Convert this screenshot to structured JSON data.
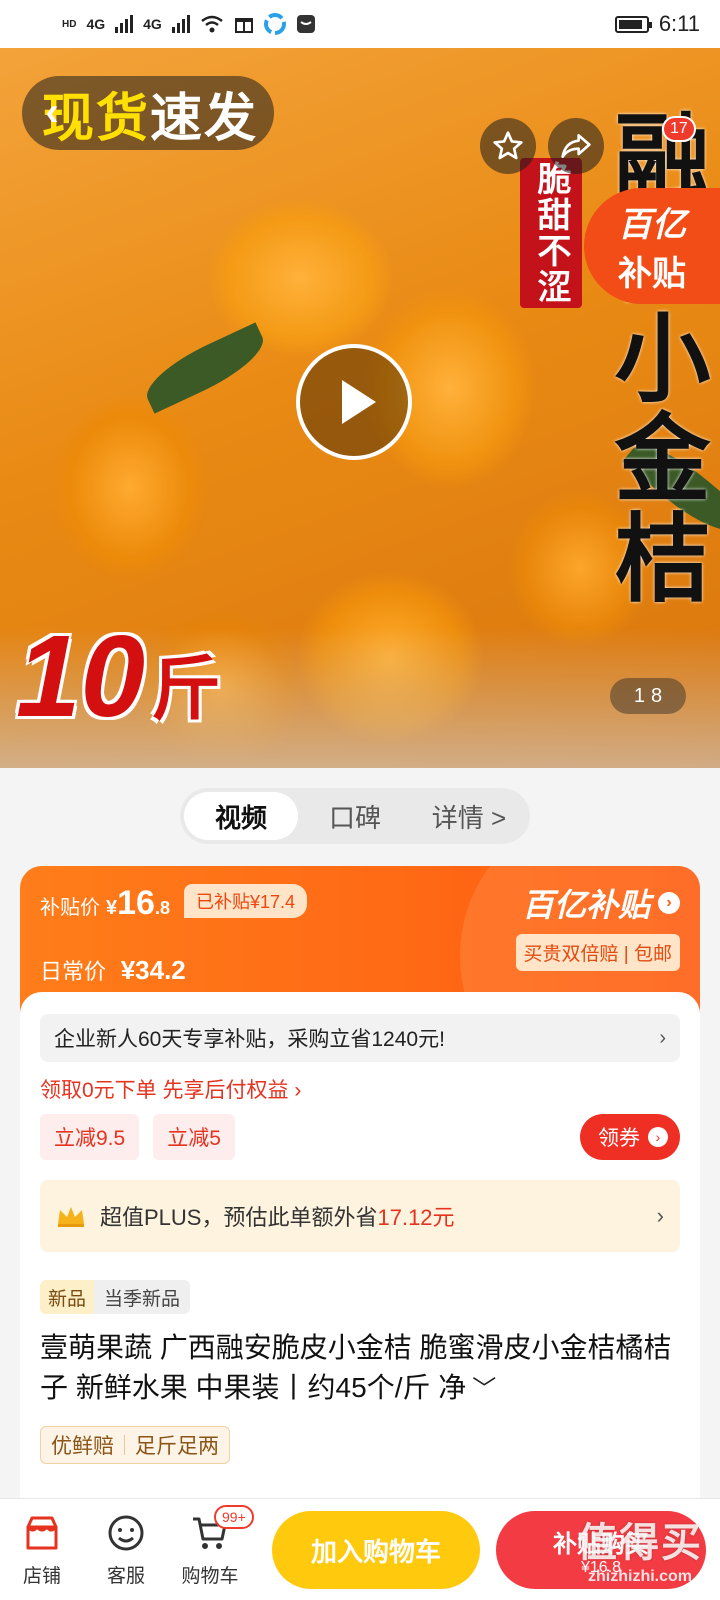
{
  "status_bar": {
    "network_labels": [
      "HD",
      "4G",
      "4G"
    ],
    "time": "6:11"
  },
  "hero": {
    "tag_yellow": "现货",
    "tag_white": "速发",
    "vertical_red_text": "脆甜不涩",
    "vertical_big_text": "融安小金桔",
    "subsidy_logo_line1": "百亿",
    "subsidy_logo_line2": "补贴",
    "weight_number": "10",
    "weight_unit": "斤",
    "cart_badge_count": "17",
    "pager_current": "1",
    "pager_total": "8"
  },
  "tabs": [
    {
      "label": "视频",
      "active": true
    },
    {
      "label": "口碑",
      "active": false
    },
    {
      "label": "详情 >",
      "active": false
    }
  ],
  "price": {
    "subsidy_label": "补贴价",
    "currency": "¥",
    "price_int": "16",
    "price_dec": ".8",
    "subsidized_tag": "已补贴¥17.4",
    "daily_label": "日常价",
    "daily_price": "¥34.2",
    "brand": "百亿补贴",
    "slogan": "买贵双倍赔 | 包邮"
  },
  "promos": {
    "enterprise_text_a": "企业新人",
    "enterprise_days": "60天",
    "enterprise_text_b": "专享补贴，采购立省",
    "enterprise_amount": "1240元!",
    "pay_later": "领取0元下单 先享后付权益 ›",
    "coupons": [
      "立减9.5",
      "立减5"
    ],
    "get_coupon": "领券",
    "plus_text": "超值PLUS，预估此单额外省",
    "plus_amount": "17.12元"
  },
  "product": {
    "tag_new": "新品",
    "tag_season": "当季新品",
    "title": "壹萌果蔬 广西融安脆皮小金桔 脆蜜滑皮小金桔橘桔子 新鲜水果 中果装丨约45个/斤 净",
    "guarantees": [
      "优鲜赔",
      "足斤足两"
    ]
  },
  "bottom_bar": {
    "store_label": "店铺",
    "service_label": "客服",
    "cart_label": "购物车",
    "cart_badge": "99+",
    "add_to_cart": "加入购物车",
    "buy_label": "补贴购买",
    "buy_price": "¥16.8"
  },
  "watermark": {
    "line1": "值得买",
    "line2": "zhizhizhi.com"
  },
  "colors": {
    "accent_red": "#ef2f24",
    "subsidy_orange": "#ff5a10",
    "cart_yellow": "#ffc90e",
    "buy_red": "#f23b42"
  }
}
